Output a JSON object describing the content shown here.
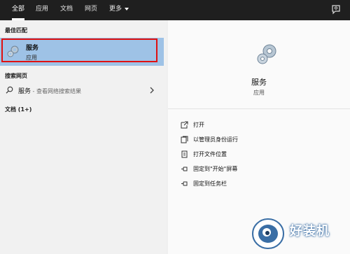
{
  "tabs": [
    {
      "label": "全部",
      "active": true
    },
    {
      "label": "应用"
    },
    {
      "label": "文档"
    },
    {
      "label": "网页"
    },
    {
      "label": "更多"
    }
  ],
  "icons": {
    "more": "chevron-down-icon",
    "feedback": "feedback-icon",
    "service": "gear-icon",
    "search": "search-icon",
    "arrow": "chevron-right-icon",
    "open": "open-icon",
    "run_admin": "run-as-admin-icon",
    "open_location": "folder-location-icon",
    "pin_start": "pin-icon",
    "pin_taskbar": "pin-icon"
  },
  "sections": {
    "best_match": "最佳匹配",
    "web": "搜索网页",
    "documents": "文档 (1+)"
  },
  "best_match": {
    "title": "服务",
    "subtitle": "应用"
  },
  "web_result": {
    "query": "服务",
    "suffix": " - 查看网络搜索结果"
  },
  "detail": {
    "title": "服务",
    "subtitle": "应用",
    "actions": [
      {
        "label": "打开"
      },
      {
        "label": "以管理员身份运行"
      },
      {
        "label": "打开文件位置"
      },
      {
        "label": "固定到\"开始\"屏幕"
      },
      {
        "label": "固定到任务栏"
      }
    ]
  },
  "watermark": "好装机",
  "colors": {
    "topbar": "#1f1f1f",
    "selection": "#9ec2e6",
    "highlight_border": "#e01010"
  }
}
